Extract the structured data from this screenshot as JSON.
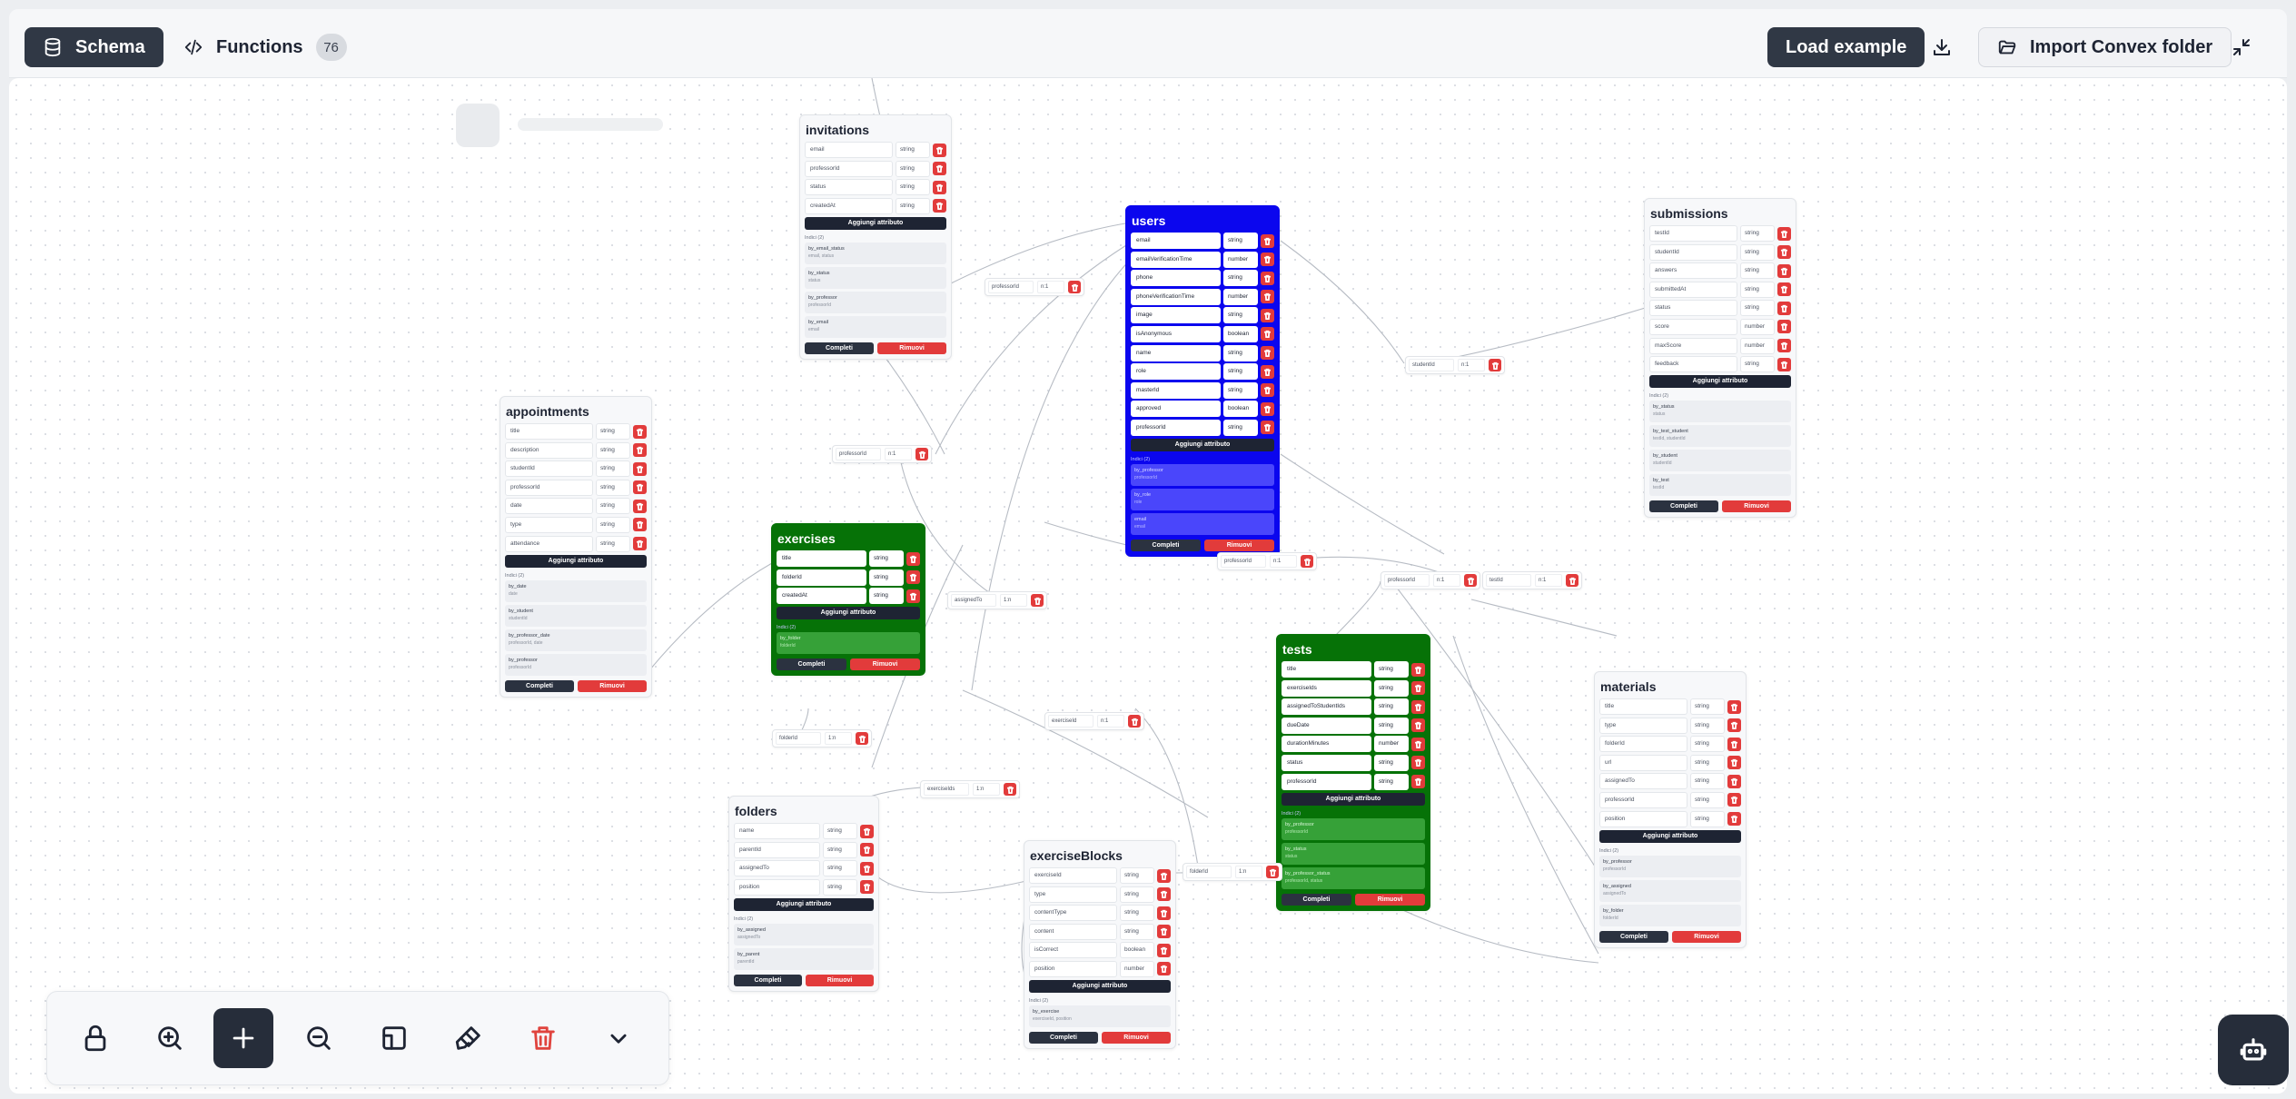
{
  "topbar": {
    "schema_tab": "Schema",
    "functions_tab": "Functions",
    "functions_count": "76",
    "load_example": "Load example",
    "import_folder": "Import Convex folder"
  },
  "labels": {
    "add_attribute": "Aggiungi attributo",
    "complete": "Completi",
    "remove": "Rimuovi",
    "index_header": "Indici (2)"
  },
  "tables": [
    {
      "id": "invitations",
      "title": "invitations",
      "style": "default",
      "fields": [
        [
          "email",
          "string"
        ],
        [
          "professorId",
          "string"
        ],
        [
          "status",
          "string"
        ],
        [
          "createdAt",
          "string"
        ]
      ],
      "indexes": [
        [
          "by_email_status",
          "email, status"
        ],
        [
          "by_status",
          "status"
        ],
        [
          "by_professor",
          "professorId"
        ],
        [
          "by_email",
          "email"
        ]
      ]
    },
    {
      "id": "users",
      "title": "users",
      "style": "blue",
      "fields": [
        [
          "email",
          "string"
        ],
        [
          "emailVerificationTime",
          "number"
        ],
        [
          "phone",
          "string"
        ],
        [
          "phoneVerificationTime",
          "number"
        ],
        [
          "image",
          "string"
        ],
        [
          "isAnonymous",
          "boolean"
        ],
        [
          "name",
          "string"
        ],
        [
          "role",
          "string"
        ],
        [
          "masterId",
          "string"
        ],
        [
          "approved",
          "boolean"
        ],
        [
          "professorId",
          "string"
        ]
      ],
      "indexes": [
        [
          "by_professor",
          "professorId"
        ],
        [
          "by_role",
          "role"
        ],
        [
          "email",
          "email"
        ]
      ]
    },
    {
      "id": "submissions",
      "title": "submissions",
      "style": "default",
      "fields": [
        [
          "testId",
          "string"
        ],
        [
          "studentId",
          "string"
        ],
        [
          "answers",
          "string"
        ],
        [
          "submittedAt",
          "string"
        ],
        [
          "status",
          "string"
        ],
        [
          "score",
          "number"
        ],
        [
          "maxScore",
          "number"
        ],
        [
          "feedback",
          "string"
        ]
      ],
      "indexes": [
        [
          "by_status",
          "status"
        ],
        [
          "by_test_student",
          "testId, studentId"
        ],
        [
          "by_student",
          "studentId"
        ],
        [
          "by_test",
          "testId"
        ]
      ]
    },
    {
      "id": "appointments",
      "title": "appointments",
      "style": "default",
      "fields": [
        [
          "title",
          "string"
        ],
        [
          "description",
          "string"
        ],
        [
          "studentId",
          "string"
        ],
        [
          "professorId",
          "string"
        ],
        [
          "date",
          "string"
        ],
        [
          "type",
          "string"
        ],
        [
          "attendance",
          "string"
        ]
      ],
      "indexes": [
        [
          "by_date",
          "date"
        ],
        [
          "by_student",
          "studentId"
        ],
        [
          "by_professor_date",
          "professorId, date"
        ],
        [
          "by_professor",
          "professorId"
        ]
      ]
    },
    {
      "id": "exercises",
      "title": "exercises",
      "style": "green",
      "fields": [
        [
          "title",
          "string"
        ],
        [
          "folderId",
          "string"
        ],
        [
          "createdAt",
          "string"
        ]
      ],
      "indexes": [
        [
          "by_folder",
          "folderId"
        ]
      ]
    },
    {
      "id": "tests",
      "title": "tests",
      "style": "green",
      "fields": [
        [
          "title",
          "string"
        ],
        [
          "exerciseIds",
          "string"
        ],
        [
          "assignedToStudentIds",
          "string"
        ],
        [
          "dueDate",
          "string"
        ],
        [
          "durationMinutes",
          "number"
        ],
        [
          "status",
          "string"
        ],
        [
          "professorId",
          "string"
        ]
      ],
      "indexes": [
        [
          "by_professor",
          "professorId"
        ],
        [
          "by_status",
          "status"
        ],
        [
          "by_professor_status",
          "professorId, status"
        ]
      ]
    },
    {
      "id": "materials",
      "title": "materials",
      "style": "default",
      "fields": [
        [
          "title",
          "string"
        ],
        [
          "type",
          "string"
        ],
        [
          "folderId",
          "string"
        ],
        [
          "url",
          "string"
        ],
        [
          "assignedTo",
          "string"
        ],
        [
          "professorId",
          "string"
        ],
        [
          "position",
          "string"
        ]
      ],
      "indexes": [
        [
          "by_professor",
          "professorId"
        ],
        [
          "by_assigned",
          "assignedTo"
        ],
        [
          "by_folder",
          "folderId"
        ]
      ]
    },
    {
      "id": "folders",
      "title": "folders",
      "style": "default",
      "fields": [
        [
          "name",
          "string"
        ],
        [
          "parentId",
          "string"
        ],
        [
          "assignedTo",
          "string"
        ],
        [
          "position",
          "string"
        ]
      ],
      "indexes": [
        [
          "by_assigned",
          "assignedTo"
        ],
        [
          "by_parent",
          "parentId"
        ]
      ]
    },
    {
      "id": "exerciseBlocks",
      "title": "exerciseBlocks",
      "style": "default",
      "fields": [
        [
          "exerciseId",
          "string"
        ],
        [
          "type",
          "string"
        ],
        [
          "contentType",
          "string"
        ],
        [
          "content",
          "string"
        ],
        [
          "isCorrect",
          "boolean"
        ],
        [
          "position",
          "number"
        ]
      ],
      "indexes": [
        [
          "by_exercise",
          "exerciseId, position"
        ]
      ]
    }
  ],
  "relations": [
    {
      "id": "r1",
      "field": "professorId",
      "card": "n:1"
    },
    {
      "id": "r2",
      "field": "studentId",
      "card": "n:1"
    },
    {
      "id": "r3",
      "field": "professorId",
      "card": "n:1"
    },
    {
      "id": "r4",
      "field": "assignedTo",
      "card": "1:n"
    },
    {
      "id": "r5",
      "field": "professorId",
      "card": "n:1"
    },
    {
      "id": "r6",
      "field": "testId",
      "card": "n:1"
    },
    {
      "id": "r7",
      "field": "folderId",
      "card": "1:n"
    },
    {
      "id": "r8",
      "field": "exerciseIds",
      "card": "1:n"
    },
    {
      "id": "r9",
      "field": "exerciseId",
      "card": "n:1"
    },
    {
      "id": "r10",
      "field": "folderId",
      "card": "1:n"
    },
    {
      "id": "r11",
      "field": "professorId",
      "card": "n:1"
    }
  ],
  "icons": {
    "schema": "database-icon",
    "functions": "code-icon",
    "download": "download-icon",
    "import": "folder-open-icon",
    "collapse": "minimize-icon",
    "lock": "lock-icon",
    "zoom_in": "zoom-in-icon",
    "add": "plus-icon",
    "zoom_out": "zoom-out-icon",
    "fit": "fit-view-icon",
    "paint": "paintbrush-icon",
    "trash": "trash-icon",
    "more": "chevron-down-icon",
    "assistant": "bot-icon"
  },
  "colors": {
    "accent_dark": "#303845",
    "blue_table": "#0b06ee",
    "green_table": "#067207",
    "danger": "#e23b3b"
  }
}
